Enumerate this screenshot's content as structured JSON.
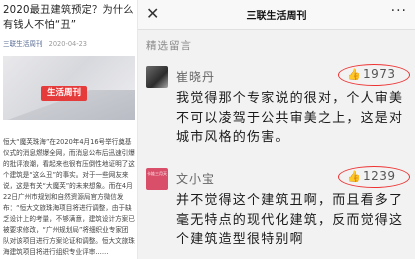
{
  "article": {
    "title": "2020最丑建筑预定？为什么有钱人不怕“丑”",
    "account": "三联生活周刊",
    "date": "2020-04-23",
    "logo_text": "生活周刊",
    "body": "恒大“魔芙珠海”在2020年4月16号举行奠基仪式的消息燃爆全网，而消息公布后迅速引爆的批评浪潮，看起来也很有压倒性地证明了这个建筑是“这么丑”的事实。对于一些网友来说，这是有关“大魔芙”的未来想象。而在4月22日广州市规划和自然资源局官方微信发布：“恒大文旅珠海项目将进行调整，由于缺乏设计上的考量，不够满意，建筑设计方案已被要求修改，“广州规划局”将细织业专家团队对该项目进行方案论证和调整。恒大文旅珠海建筑项目将进行组织专业评审……"
  },
  "navbar": {
    "close_glyph": "✕",
    "title": "三联生活周刊",
    "more_glyph": "···"
  },
  "section_title": "精选留言",
  "comments": [
    {
      "name": "崔晓丹",
      "likes": "1973",
      "text": "我觉得那个专家说的很对，个人审美不可以凌驾于公共审美之上，这是对城市风格的伤害。"
    },
    {
      "name": "文小宝",
      "likes": "1239",
      "avatar_text": "卡娃三月天",
      "text": "并不觉得这个建筑丑啊，而且看多了毫无特点的现代化建筑，反而觉得这个建筑造型很特别啊"
    }
  ],
  "colors": {
    "highlight": "#e33333",
    "link": "#576b95"
  }
}
